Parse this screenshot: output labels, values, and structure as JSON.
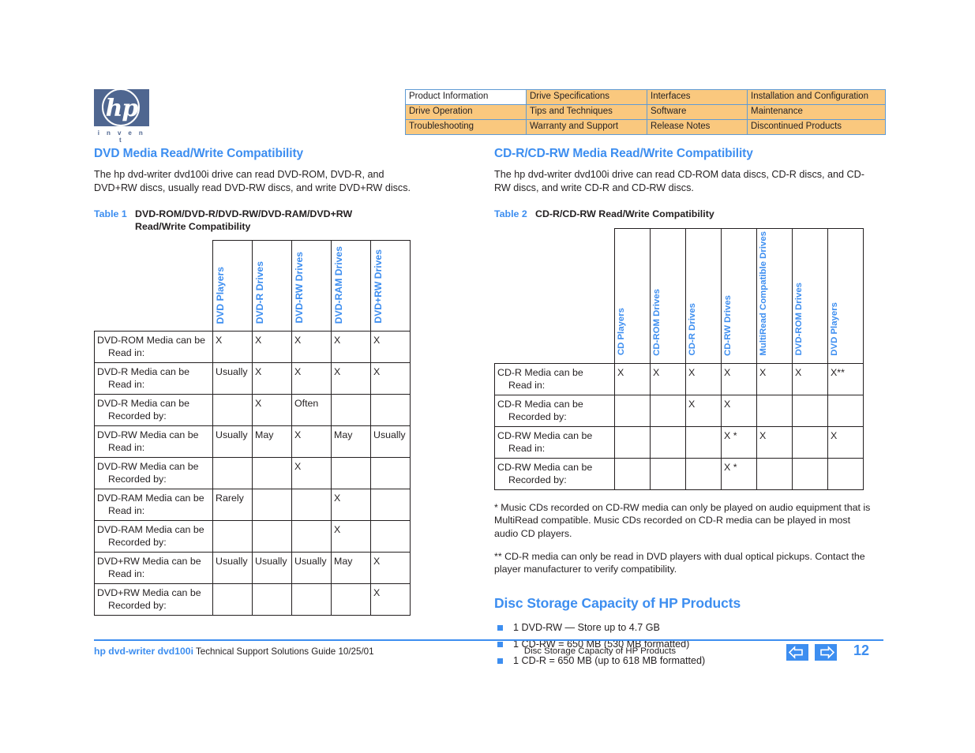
{
  "logo": {
    "wordmark": "hp",
    "tagline": "i n v e n t"
  },
  "nav_table": {
    "rows": [
      [
        {
          "label": "Product Information",
          "current": true
        },
        {
          "label": "Drive Specifications",
          "current": false
        },
        {
          "label": "Interfaces",
          "current": false
        },
        {
          "label": "Installation and Configuration",
          "current": false
        }
      ],
      [
        {
          "label": "Drive Operation",
          "current": false
        },
        {
          "label": "Tips and Techniques",
          "current": false
        },
        {
          "label": "Software",
          "current": false
        },
        {
          "label": "Maintenance",
          "current": false
        }
      ],
      [
        {
          "label": "Troubleshooting",
          "current": false
        },
        {
          "label": "Warranty and Support",
          "current": false
        },
        {
          "label": "Release Notes",
          "current": false
        },
        {
          "label": "Discontinued Products",
          "current": false
        }
      ]
    ]
  },
  "left": {
    "heading": "DVD Media Read/Write Compatibility",
    "intro": "The hp dvd-writer dvd100i drive can read DVD-ROM, DVD-R, and DVD+RW discs, usually read DVD-RW discs, and write DVD+RW discs.",
    "caption_num": "Table 1",
    "caption_line1": "DVD-ROM/DVD-R/DVD-RW/DVD-RAM/DVD+RW",
    "caption_line2": "Read/Write Compatibility",
    "table": {
      "columns": [
        "DVD Players",
        "DVD-R Drives",
        "DVD-RW Drives",
        "DVD-RAM Drives",
        "DVD+RW Drives"
      ],
      "rows": [
        {
          "label1": "DVD-ROM Media can be",
          "label2": "Read in:",
          "cells": [
            "X",
            "X",
            "X",
            "X",
            "X"
          ]
        },
        {
          "label1": "DVD-R Media can be",
          "label2": "Read in:",
          "cells": [
            "Usually",
            "X",
            "X",
            "X",
            "X"
          ]
        },
        {
          "label1": "DVD-R Media can be",
          "label2": "Recorded by:",
          "cells": [
            "",
            "X",
            "Often",
            "",
            ""
          ]
        },
        {
          "label1": "DVD-RW Media can be",
          "label2": "Read in:",
          "cells": [
            "Usually",
            "May",
            "X",
            "May",
            "Usually"
          ]
        },
        {
          "label1": "DVD-RW Media can be",
          "label2": "Recorded by:",
          "cells": [
            "",
            "",
            "X",
            "",
            ""
          ]
        },
        {
          "label1": "DVD-RAM Media can be",
          "label2": "Read in:",
          "cells": [
            "Rarely",
            "",
            "",
            "X",
            ""
          ]
        },
        {
          "label1": "DVD-RAM Media can be",
          "label2": "Recorded by:",
          "cells": [
            "",
            "",
            "",
            "X",
            ""
          ]
        },
        {
          "label1": "DVD+RW Media can be",
          "label2": "Read in:",
          "cells": [
            "Usually",
            "Usually",
            "Usually",
            "May",
            "X"
          ]
        },
        {
          "label1": "DVD+RW Media can be",
          "label2": "Recorded by:",
          "cells": [
            "",
            "",
            "",
            "",
            "X"
          ]
        }
      ]
    }
  },
  "right": {
    "heading": "CD-R/CD-RW Media Read/Write Compatibility",
    "intro": "The hp dvd-writer dvd100i drive can read CD-ROM data discs, CD-R discs, and CD-RW discs, and write CD-R and CD-RW discs.",
    "caption_num": "Table 2",
    "caption_line1": "CD-R/CD-RW Read/Write Compatibility",
    "table": {
      "columns": [
        "CD Players",
        "CD-ROM Drives",
        "CD-R Drives",
        "CD-RW Drives",
        "MultiRead Compatible Drives",
        "DVD-ROM Drives",
        "DVD Players"
      ],
      "rows": [
        {
          "label1": "CD-R Media can be",
          "label2": "Read in:",
          "cells": [
            "X",
            "X",
            "X",
            "X",
            "X",
            "X",
            "X**"
          ]
        },
        {
          "label1": "CD-R Media can be",
          "label2": "Recorded by:",
          "cells": [
            "",
            "",
            "X",
            "X",
            "",
            "",
            ""
          ]
        },
        {
          "label1": "CD-RW Media can be",
          "label2": "Read in:",
          "cells": [
            "",
            "",
            "",
            "X *",
            "X",
            "",
            "X"
          ]
        },
        {
          "label1": "CD-RW Media can be",
          "label2": "Recorded by:",
          "cells": [
            "",
            "",
            "",
            "X *",
            "",
            "",
            ""
          ]
        }
      ]
    },
    "footnote1": "* Music CDs recorded on CD-RW media can only be played on audio equipment that is MultiRead compatible. Music CDs recorded on CD-R media can be played in most audio CD players.",
    "footnote2": "** CD-R media can only be read in DVD players with dual optical pickups. Contact the player manufacturer to verify compatibility.",
    "capacity_heading": "Disc Storage Capacity of HP Products",
    "capacity_items": [
      "1 DVD-RW — Store up to 4.7 GB",
      "1 CD-RW = 650 MB (530 MB formatted)",
      "1 CD-R = 650 MB (up to 618 MB formatted)"
    ]
  },
  "footer": {
    "brand": "hp dvd-writer  dvd100i",
    "guide": "Technical Support Solutions Guide 10/25/01",
    "center": "Disc Storage Capacity of HP Products",
    "page": "12"
  },
  "colors": {
    "accent_blue": "#3d8ef0",
    "nav_orange": "#fac87e",
    "nav_border": "#5f9bd5",
    "logo_blue": "#4f6690",
    "text": "#231f20"
  }
}
